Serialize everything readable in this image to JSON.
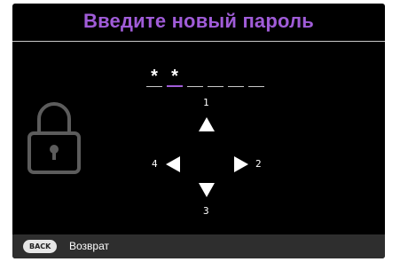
{
  "dialog": {
    "title": "Введите новый пароль"
  },
  "password": {
    "masked_chars": [
      "*",
      "*",
      "",
      "",
      "",
      ""
    ],
    "active_index": 1
  },
  "keypad": {
    "up_label": "1",
    "right_label": "2",
    "down_label": "3",
    "left_label": "4"
  },
  "footer": {
    "back_key": "BACK",
    "back_label": "Возврат"
  },
  "colors": {
    "title": "#a05cd8",
    "active_slot": "#a05cd8",
    "background": "#000000",
    "footer_bg": "#2e2e2e",
    "lock_icon": "#5c5c5c"
  },
  "icons": {
    "lock": "lock-icon",
    "up": "arrow-up-icon",
    "down": "arrow-down-icon",
    "left": "arrow-left-icon",
    "right": "arrow-right-icon"
  }
}
